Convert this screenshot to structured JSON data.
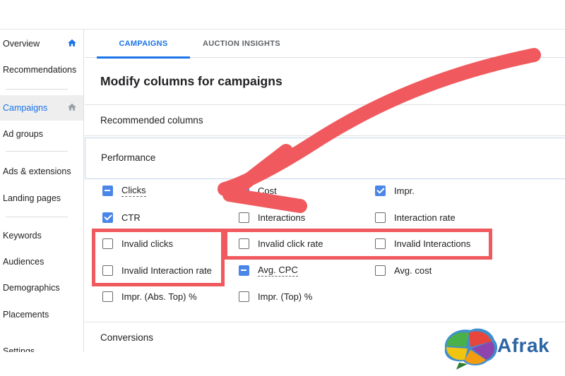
{
  "sidebar": {
    "items": [
      {
        "label": "Overview",
        "icon": "home-icon",
        "active": false
      },
      {
        "label": "Recommendations",
        "active": false
      },
      {
        "label": "Campaigns",
        "icon": "home-icon",
        "active": true
      },
      {
        "label": "Ad groups",
        "active": false
      },
      {
        "label": "Ads & extensions",
        "active": false
      },
      {
        "label": "Landing pages",
        "active": false
      },
      {
        "label": "Keywords",
        "active": false
      },
      {
        "label": "Audiences",
        "active": false
      },
      {
        "label": "Demographics",
        "active": false
      },
      {
        "label": "Placements",
        "active": false
      },
      {
        "label": "Settings",
        "active": false
      }
    ]
  },
  "tabs": [
    {
      "label": "CAMPAIGNS",
      "active": true
    },
    {
      "label": "AUCTION INSIGHTS",
      "active": false
    }
  ],
  "dialog": {
    "title": "Modify columns for campaigns",
    "sections": {
      "recommended": "Recommended columns",
      "performance": "Performance",
      "conversions": "Conversions"
    },
    "options": [
      {
        "label": "Clicks",
        "state": "partial",
        "dotted": true
      },
      {
        "label": "Cost",
        "state": "checked",
        "dotted": false
      },
      {
        "label": "Impr.",
        "state": "checked",
        "dotted": false
      },
      {
        "label": "CTR",
        "state": "checked",
        "dotted": false
      },
      {
        "label": "Interactions",
        "state": "unchecked",
        "dotted": false
      },
      {
        "label": "Interaction rate",
        "state": "unchecked",
        "dotted": false
      },
      {
        "label": "Invalid clicks",
        "state": "unchecked",
        "dotted": false
      },
      {
        "label": "Invalid click rate",
        "state": "unchecked",
        "dotted": false
      },
      {
        "label": "Invalid Interactions",
        "state": "unchecked",
        "dotted": false
      },
      {
        "label": "Invalid Interaction rate",
        "state": "unchecked",
        "dotted": false
      },
      {
        "label": "Avg. CPC",
        "state": "partial",
        "dotted": true
      },
      {
        "label": "Avg. cost",
        "state": "unchecked",
        "dotted": false
      },
      {
        "label": "Impr. (Abs. Top) %",
        "state": "unchecked",
        "dotted": false
      },
      {
        "label": "Impr. (Top) %",
        "state": "unchecked",
        "dotted": false
      }
    ]
  },
  "logo": {
    "text": "Afrak"
  },
  "colors": {
    "accent": "#1a73e8",
    "checkbox_fill": "#4a86e8",
    "highlight": "#f05a5e",
    "logo_text": "#2c64a4"
  }
}
